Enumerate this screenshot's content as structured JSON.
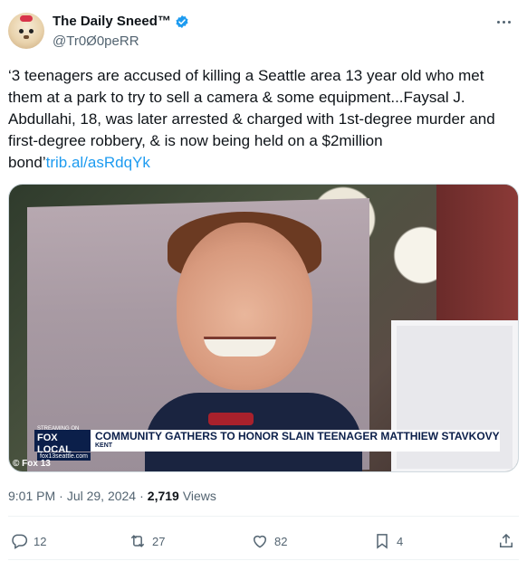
{
  "author": {
    "display_name": "The Daily Sneed™",
    "handle": "@Tr0Ø0peRR",
    "verified": true,
    "avatar_icon": "cartoon-dog-avatar"
  },
  "tweet": {
    "text": "‘3 teenagers are accused of killing a Seattle area 13 year old who met them at a park to try to sell a camera & some equipment...Faysal J. Abdullahi, 18, was later arrested & charged with 1st-degree murder and first-degree robbery, & is now being held on a $2million bond’",
    "link": "trib.al/asRdqYk"
  },
  "media": {
    "chyron_streaming": "STREAMING ON",
    "chyron_brand": "FOX LOCAL",
    "chyron_headline": "COMMUNITY GATHERS TO HONOR SLAIN TEENAGER MATTHIEW STAVKOVY",
    "chyron_location": "KENT",
    "site": "fox13seattle.com",
    "credit": "© Fox 13"
  },
  "meta": {
    "time": "9:01 PM",
    "separator": "·",
    "date": "Jul 29, 2024",
    "separator2": "·",
    "views_count": "2,719",
    "views_label": "Views"
  },
  "actions": {
    "replies": "12",
    "retweets": "27",
    "likes": "82",
    "bookmarks": "4"
  },
  "colors": {
    "accent": "#1d9bf0",
    "text_secondary": "#536471"
  }
}
